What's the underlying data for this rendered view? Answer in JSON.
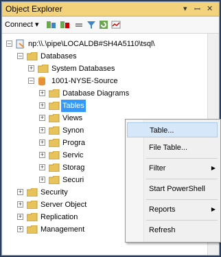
{
  "panel": {
    "title": "Object Explorer",
    "controls": {
      "dropdown": "▾",
      "pin": "ꟷ",
      "close": "✕"
    }
  },
  "toolbar": {
    "connect_label": "Connect ▾"
  },
  "tree": {
    "root": "np:\\\\.\\pipe\\LOCALDB#SH4A5110\\tsql\\",
    "databases": "Databases",
    "system_databases": "System Databases",
    "db_name": "1001-NYSE-Source",
    "children": [
      "Database Diagrams",
      "Tables",
      "Views",
      "Synon",
      "Progra",
      "Servic",
      "Storag",
      "Securi"
    ],
    "top_level": [
      "Security",
      "Server Object",
      "Replication",
      "Management"
    ]
  },
  "context_menu": {
    "items": [
      "Table...",
      "File Table...",
      "Filter",
      "Start PowerShell",
      "Reports",
      "Refresh"
    ]
  },
  "colors": {
    "titlebar": "#f2d27a",
    "selection": "#3399ff",
    "folder": "#e8c25a"
  }
}
